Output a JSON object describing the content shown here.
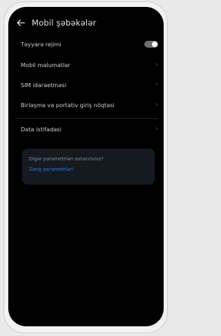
{
  "header": {
    "title": "Mobil şəbəkələr",
    "back_icon": "back-arrow-icon"
  },
  "settings": [
    {
      "label": "Təyyarə rejimi",
      "control": "toggle",
      "state": "on"
    },
    {
      "label": "Mobil məlumatlar",
      "control": "chevron"
    },
    {
      "label": "SIM idarəetməsi",
      "control": "chevron"
    },
    {
      "label": "Birləşmə və portativ giriş nöqtəsi",
      "control": "chevron"
    },
    {
      "label": "Data istifadəsi",
      "control": "chevron"
    }
  ],
  "suggestion": {
    "question": "Digər parametrləri axtarırsınız?",
    "link": "Zəng parametrləri"
  },
  "colors": {
    "background": "#000000",
    "accent": "#3a79d1",
    "card": "#151a20"
  }
}
